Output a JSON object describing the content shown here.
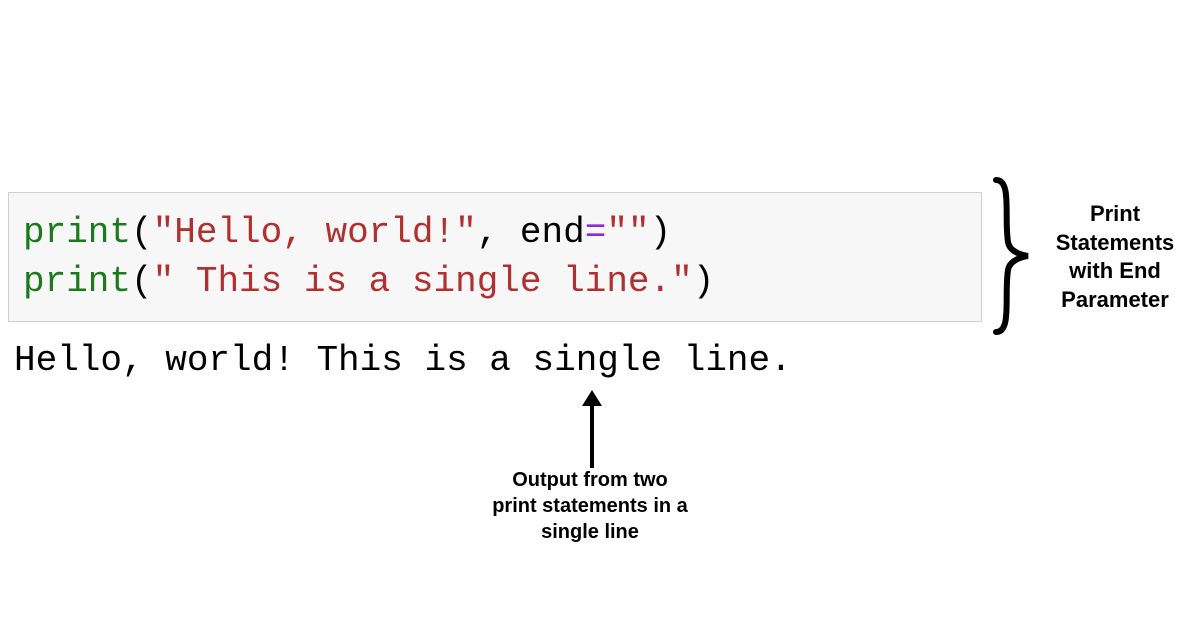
{
  "code": {
    "line1": {
      "func": "print",
      "open": "(",
      "str1": "\"Hello, world!\"",
      "comma_space": ", ",
      "param": "end",
      "eq": "=",
      "str2": "\"\"",
      "close": ")"
    },
    "line2": {
      "func": "print",
      "open": "(",
      "str1": "\" This is a single line.\"",
      "close": ")"
    }
  },
  "output": "Hello, world! This is a single line.",
  "annotations": {
    "right": "Print Statements with End Parameter",
    "bottom": "Output from two print statements in a single line"
  }
}
